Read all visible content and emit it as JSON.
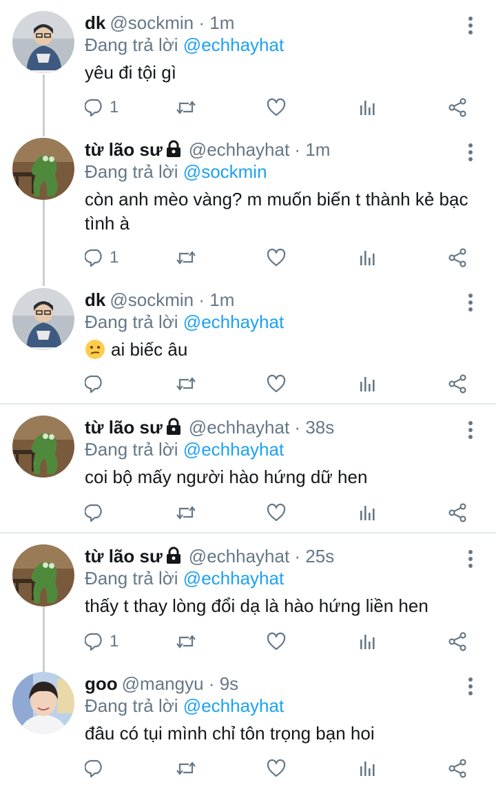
{
  "labels": {
    "replying_prefix": "Đang trả lời"
  },
  "colors": {
    "link": "#1da1f2",
    "muted": "#657786",
    "thread_line": "#c4cfd6",
    "divider": "#e1e8ed"
  },
  "icons": [
    "reply-icon",
    "retweet-icon",
    "like-icon",
    "analytics-icon",
    "share-icon",
    "more-icon",
    "lock-icon"
  ],
  "tweets": [
    {
      "name": "dk",
      "handle": "@sockmin",
      "dot": "·",
      "time": "1m",
      "locked": false,
      "reply_to": "@echhayhat",
      "text": "yêu đi tội gì",
      "reply_count": "1"
    },
    {
      "name": "từ lão sư",
      "handle": "@echhayhat",
      "dot": "·",
      "time": "1m",
      "locked": true,
      "reply_to": "@sockmin",
      "text": "còn anh mèo vàng? m muốn biến t thành kẻ bạc tình à",
      "reply_count": "1"
    },
    {
      "name": "dk",
      "handle": "@sockmin",
      "dot": "·",
      "time": "1m",
      "locked": false,
      "reply_to": "@echhayhat",
      "text": "ai biếc âu",
      "emoji": "confused-face",
      "reply_count": ""
    },
    {
      "name": "từ lão sư",
      "handle": "@echhayhat",
      "dot": "·",
      "time": "38s",
      "locked": true,
      "reply_to": "@echhayhat",
      "text": "coi bộ mấy người hào hứng dữ hen",
      "reply_count": ""
    },
    {
      "name": "từ lão sư",
      "handle": "@echhayhat",
      "dot": "·",
      "time": "25s",
      "locked": true,
      "reply_to": "@echhayhat",
      "text": "thấy t thay lòng đổi dạ là hào hứng liền hen",
      "reply_count": "1"
    },
    {
      "name": "goo",
      "handle": "@mangyu",
      "dot": "·",
      "time": "9s",
      "locked": false,
      "reply_to": "@echhayhat",
      "text": "đâu có tụi mình chỉ tôn trọng bạn hoi",
      "reply_count": ""
    }
  ]
}
